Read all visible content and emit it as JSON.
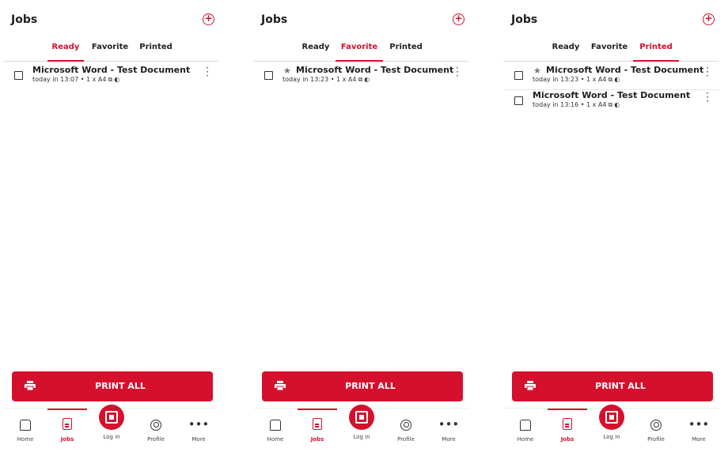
{
  "colors": {
    "accent": "#d5102d",
    "text": "#1e1e1e"
  },
  "screens": [
    {
      "title": "Jobs",
      "add_icon": "add-circle-icon",
      "tabs": [
        "Ready",
        "Favorite",
        "Printed"
      ],
      "active_tab": "Ready",
      "jobs": [
        {
          "favorite": false,
          "title": "Microsoft Word - Test Document",
          "meta": "today in 13:07 • 1 x A4"
        }
      ]
    },
    {
      "title": "Jobs",
      "add_icon": "add-circle-icon",
      "tabs": [
        "Ready",
        "Favorite",
        "Printed"
      ],
      "active_tab": "Favorite",
      "jobs": [
        {
          "favorite": true,
          "title": "Microsoft Word - Test Document",
          "meta": "today in 13:23 • 1 x A4"
        }
      ]
    },
    {
      "title": "Jobs",
      "add_icon": "add-circle-icon",
      "tabs": [
        "Ready",
        "Favorite",
        "Printed"
      ],
      "active_tab": "Printed",
      "jobs": [
        {
          "favorite": true,
          "title": "Microsoft Word - Test Document",
          "meta": "today in 13:23 • 1 x A4"
        },
        {
          "favorite": false,
          "title": "Microsoft Word - Test Document",
          "meta": "today in 13:16 • 1 x A4"
        }
      ]
    }
  ],
  "print_all_label": "PRINT ALL",
  "nav": {
    "home": "Home",
    "jobs": "Jobs",
    "login": "Log in",
    "profile": "Profile",
    "more": "More"
  }
}
